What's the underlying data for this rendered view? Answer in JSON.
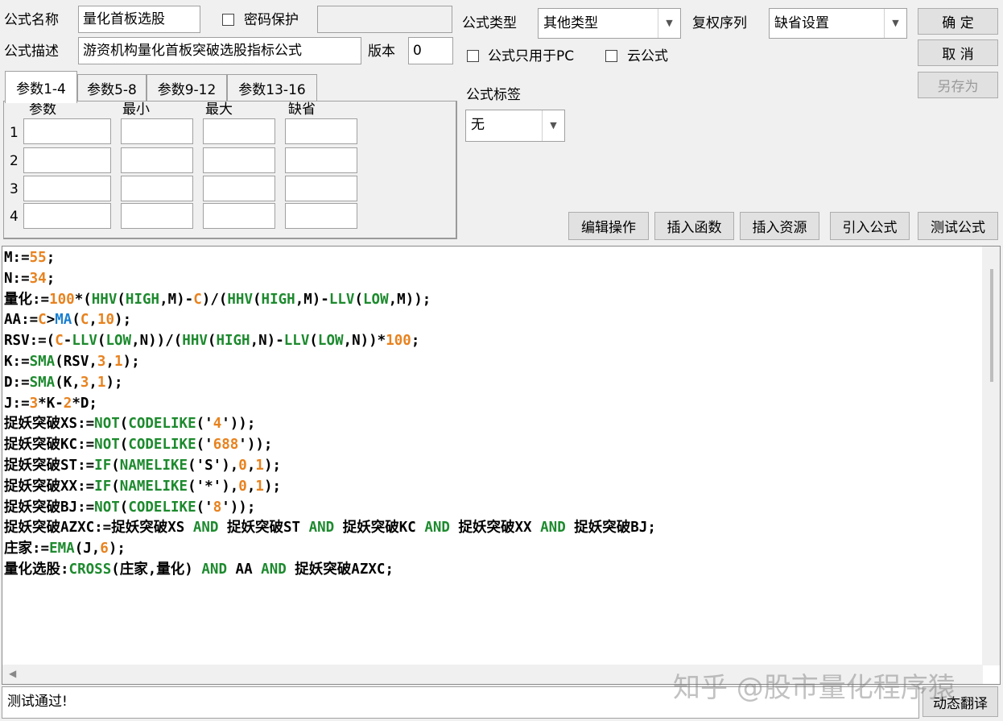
{
  "form": {
    "name_label": "公式名称",
    "name_value": "量化首板选股",
    "password_label": "密码保护",
    "desc_label": "公式描述",
    "desc_value": "游资机构量化首板突破选股指标公式",
    "version_label": "版本",
    "version_value": "0"
  },
  "type": {
    "type_label": "公式类型",
    "type_value": "其他类型",
    "rights_label": "复权序列",
    "rights_value": "缺省设置",
    "pc_only_label": "公式只用于PC",
    "cloud_label": "云公式",
    "tag_label": "公式标签",
    "tag_value": "无"
  },
  "buttons": {
    "ok": "确 定",
    "cancel": "取 消",
    "save_as": "另存为",
    "edit_ops": "编辑操作",
    "insert_func": "插入函数",
    "insert_res": "插入资源",
    "import_formula": "引入公式",
    "test_formula": "测试公式",
    "dynamic_translate": "动态翻译"
  },
  "tabs": [
    "参数1-4",
    "参数5-8",
    "参数9-12",
    "参数13-16"
  ],
  "param_table": {
    "headers": [
      "参数",
      "最小",
      "最大",
      "缺省"
    ],
    "rows": [
      "1",
      "2",
      "3",
      "4"
    ]
  },
  "colors": {
    "keyword": "#1d8a2e",
    "number": "#e8821e",
    "function_ma": "#1a7fd0",
    "text": "#000000"
  },
  "code_lines": [
    [
      [
        "M:=",
        "k"
      ],
      [
        "55",
        "n"
      ],
      [
        ";",
        "k"
      ]
    ],
    [
      [
        "N:=",
        "k"
      ],
      [
        "34",
        "n"
      ],
      [
        ";",
        "k"
      ]
    ],
    [
      [
        "量化:=",
        "k"
      ],
      [
        "100",
        "n"
      ],
      [
        "*(",
        "k"
      ],
      [
        "HHV",
        "g"
      ],
      [
        "(",
        "k"
      ],
      [
        "HIGH",
        "g"
      ],
      [
        ",M)-",
        "k"
      ],
      [
        "C",
        "n"
      ],
      [
        ")/(",
        "k"
      ],
      [
        "HHV",
        "g"
      ],
      [
        "(",
        "k"
      ],
      [
        "HIGH",
        "g"
      ],
      [
        ",M)-",
        "k"
      ],
      [
        "LLV",
        "g"
      ],
      [
        "(",
        "k"
      ],
      [
        "LOW",
        "g"
      ],
      [
        ",M));",
        "k"
      ]
    ],
    [
      [
        "AA:=",
        "k"
      ],
      [
        "C",
        "n"
      ],
      [
        ">",
        "k"
      ],
      [
        "MA",
        "b"
      ],
      [
        "(",
        "k"
      ],
      [
        "C",
        "n"
      ],
      [
        ",",
        "k"
      ],
      [
        "10",
        "n"
      ],
      [
        ");",
        "k"
      ]
    ],
    [
      [
        "RSV:=(",
        "k"
      ],
      [
        "C",
        "n"
      ],
      [
        "-",
        "k"
      ],
      [
        "LLV",
        "g"
      ],
      [
        "(",
        "k"
      ],
      [
        "LOW",
        "g"
      ],
      [
        ",N))/(",
        "k"
      ],
      [
        "HHV",
        "g"
      ],
      [
        "(",
        "k"
      ],
      [
        "HIGH",
        "g"
      ],
      [
        ",N)-",
        "k"
      ],
      [
        "LLV",
        "g"
      ],
      [
        "(",
        "k"
      ],
      [
        "LOW",
        "g"
      ],
      [
        ",N))*",
        "k"
      ],
      [
        "100",
        "n"
      ],
      [
        ";",
        "k"
      ]
    ],
    [
      [
        "K:=",
        "k"
      ],
      [
        "SMA",
        "g"
      ],
      [
        "(RSV,",
        "k"
      ],
      [
        "3",
        "n"
      ],
      [
        ",",
        "k"
      ],
      [
        "1",
        "n"
      ],
      [
        ");",
        "k"
      ]
    ],
    [
      [
        "D:=",
        "k"
      ],
      [
        "SMA",
        "g"
      ],
      [
        "(K,",
        "k"
      ],
      [
        "3",
        "n"
      ],
      [
        ",",
        "k"
      ],
      [
        "1",
        "n"
      ],
      [
        ");",
        "k"
      ]
    ],
    [
      [
        "J:=",
        "k"
      ],
      [
        "3",
        "n"
      ],
      [
        "*K-",
        "k"
      ],
      [
        "2",
        "n"
      ],
      [
        "*D;",
        "k"
      ]
    ],
    [
      [
        "捉妖突破XS:=",
        "k"
      ],
      [
        "NOT",
        "g"
      ],
      [
        "(",
        "k"
      ],
      [
        "CODELIKE",
        "g"
      ],
      [
        "('",
        "k"
      ],
      [
        "4",
        "n"
      ],
      [
        "'));",
        "k"
      ]
    ],
    [
      [
        "捉妖突破KC:=",
        "k"
      ],
      [
        "NOT",
        "g"
      ],
      [
        "(",
        "k"
      ],
      [
        "CODELIKE",
        "g"
      ],
      [
        "('",
        "k"
      ],
      [
        "688",
        "n"
      ],
      [
        "'));",
        "k"
      ]
    ],
    [
      [
        "捉妖突破ST:=",
        "k"
      ],
      [
        "IF",
        "g"
      ],
      [
        "(",
        "k"
      ],
      [
        "NAMELIKE",
        "g"
      ],
      [
        "('S'),",
        "k"
      ],
      [
        "0",
        "n"
      ],
      [
        ",",
        "k"
      ],
      [
        "1",
        "n"
      ],
      [
        ");",
        "k"
      ]
    ],
    [
      [
        "捉妖突破XX:=",
        "k"
      ],
      [
        "IF",
        "g"
      ],
      [
        "(",
        "k"
      ],
      [
        "NAMELIKE",
        "g"
      ],
      [
        "('*'),",
        "k"
      ],
      [
        "0",
        "n"
      ],
      [
        ",",
        "k"
      ],
      [
        "1",
        "n"
      ],
      [
        ");",
        "k"
      ]
    ],
    [
      [
        "捉妖突破BJ:=",
        "k"
      ],
      [
        "NOT",
        "g"
      ],
      [
        "(",
        "k"
      ],
      [
        "CODELIKE",
        "g"
      ],
      [
        "('",
        "k"
      ],
      [
        "8",
        "n"
      ],
      [
        "'));",
        "k"
      ]
    ],
    [
      [
        "捉妖突破AZXC:=捉妖突破XS ",
        "k"
      ],
      [
        "AND",
        "g"
      ],
      [
        " 捉妖突破ST ",
        "k"
      ],
      [
        "AND",
        "g"
      ],
      [
        " 捉妖突破KC ",
        "k"
      ],
      [
        "AND",
        "g"
      ],
      [
        " 捉妖突破XX ",
        "k"
      ],
      [
        "AND",
        "g"
      ],
      [
        " 捉妖突破BJ;",
        "k"
      ]
    ],
    [
      [
        "庄家:=",
        "k"
      ],
      [
        "EMA",
        "g"
      ],
      [
        "(J,",
        "k"
      ],
      [
        "6",
        "n"
      ],
      [
        ");",
        "k"
      ]
    ],
    [
      [
        "量化选股:",
        "k"
      ],
      [
        "CROSS",
        "g"
      ],
      [
        "(庄家,量化) ",
        "k"
      ],
      [
        "AND",
        "g"
      ],
      [
        " AA ",
        "k"
      ],
      [
        "AND",
        "g"
      ],
      [
        " 捉妖突破AZXC;",
        "k"
      ]
    ]
  ],
  "status": {
    "text": "测试通过!"
  },
  "watermark": "知乎 @股市量化程序猿"
}
